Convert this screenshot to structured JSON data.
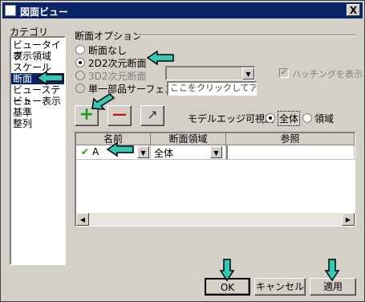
{
  "window": {
    "title": "図面ビュー",
    "close_label": "X"
  },
  "category": {
    "header": "カテゴリ",
    "items": [
      "ビュータイプ",
      "表示領域",
      "スケール",
      "断面",
      "ビューステート",
      "ビュー表示",
      "基準",
      "整列"
    ],
    "selected_index": 3
  },
  "section": {
    "header": "断面オプション",
    "radio_none": "断面なし",
    "radio_2d": "2D2次元断面",
    "radio_3d": "3D2次元断面",
    "radio_single": "単一部品サーフェス",
    "single_field_placeholder": "ここをクリックしてアイテムを追",
    "hatching_label": "ハッチングを表示",
    "selected": "2d"
  },
  "toolbar": {
    "add_label": "+",
    "remove_label": "—",
    "edit_label": "↗"
  },
  "edge_visibility": {
    "label": "モデルエッジ可視度",
    "opt_all": "全体",
    "opt_area": "領域",
    "selected": "all"
  },
  "grid": {
    "columns": [
      "名前",
      "断面領域",
      "参照"
    ],
    "rows": [
      {
        "check": "✔",
        "name": "A",
        "area": "全体",
        "ref": ""
      }
    ]
  },
  "buttons": {
    "ok": "OK",
    "cancel": "キャンセル",
    "apply": "適用"
  },
  "colors": {
    "highlight_arrow": "#33c9b4",
    "title_bar": "#0a246a",
    "selection": "#0a246a",
    "add_icon": "#1a9a1a",
    "remove_icon": "#c01010"
  }
}
